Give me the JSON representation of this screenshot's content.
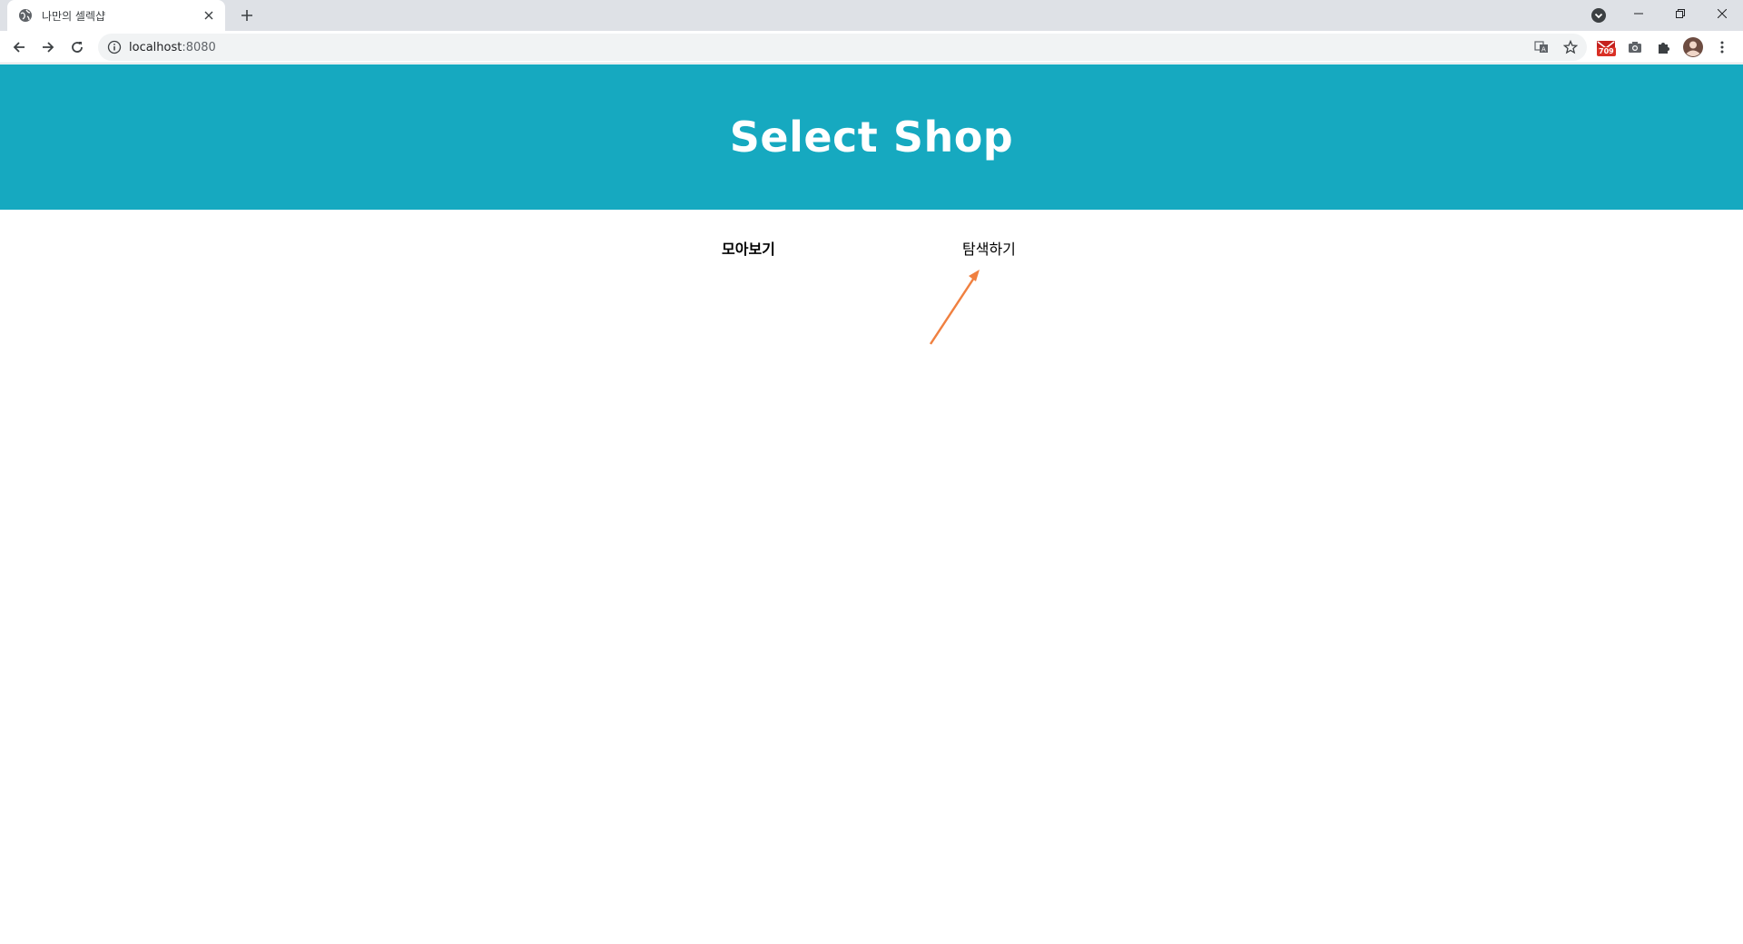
{
  "browser": {
    "tab": {
      "title": "나만의 셀렉샵"
    },
    "url": {
      "host": "localhost",
      "port": ":8080"
    },
    "extensions": {
      "mail_badge": "709"
    }
  },
  "header": {
    "title": "Select Shop"
  },
  "nav": {
    "tabs": [
      {
        "label": "모아보기",
        "active": true
      },
      {
        "label": "탐색하기",
        "active": false
      }
    ]
  },
  "colors": {
    "header_bg": "#16a9c0",
    "annotation_arrow": "#f08040"
  },
  "icons": {
    "favicon": "globe-icon",
    "annotation": "arrow-icon"
  }
}
